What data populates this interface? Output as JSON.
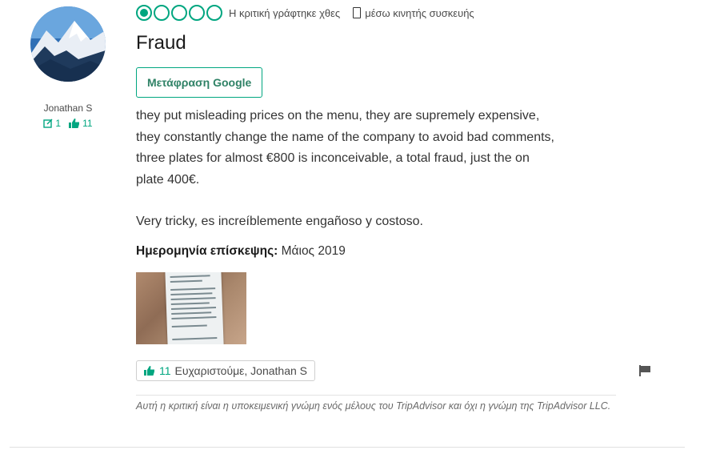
{
  "user": {
    "name": "Jonathan S",
    "reviews_count": "1",
    "helpful_votes": "11"
  },
  "review": {
    "rating": 1,
    "rating_max": 5,
    "date_text": "Η κριτική γράφτηκε χθες",
    "mobile_text": "μέσω κινητής συσκευής",
    "title": "Fraud",
    "translate_label": "Μετάφραση Google",
    "body_lines": [
      "they put misleading prices on the menu, they are supremely expensive,",
      "they constantly change the name of the company to avoid bad comments,",
      "three plates for almost €800 is inconceivable, a total fraud, just the on",
      "plate 400€."
    ],
    "body_extra": "Very tricky, es increíblemente engañoso y costoso.",
    "visit_label": "Ημερομηνία επίσκεψης:",
    "visit_value": "Μάιος 2019",
    "thanks_count": "11",
    "thanks_label": "Ευχαριστούμε, Jonathan S",
    "disclaimer": "Αυτή η κριτική είναι η υποκειμενική γνώμη ενός μέλους του TripAdvisor και όχι η γνώμη της TripAdvisor LLC."
  },
  "colors": {
    "accent": "#00a680",
    "button_text": "#2f8266"
  },
  "icons": [
    "review-count-icon",
    "thumbs-up-icon",
    "phone-icon",
    "flag-icon"
  ]
}
